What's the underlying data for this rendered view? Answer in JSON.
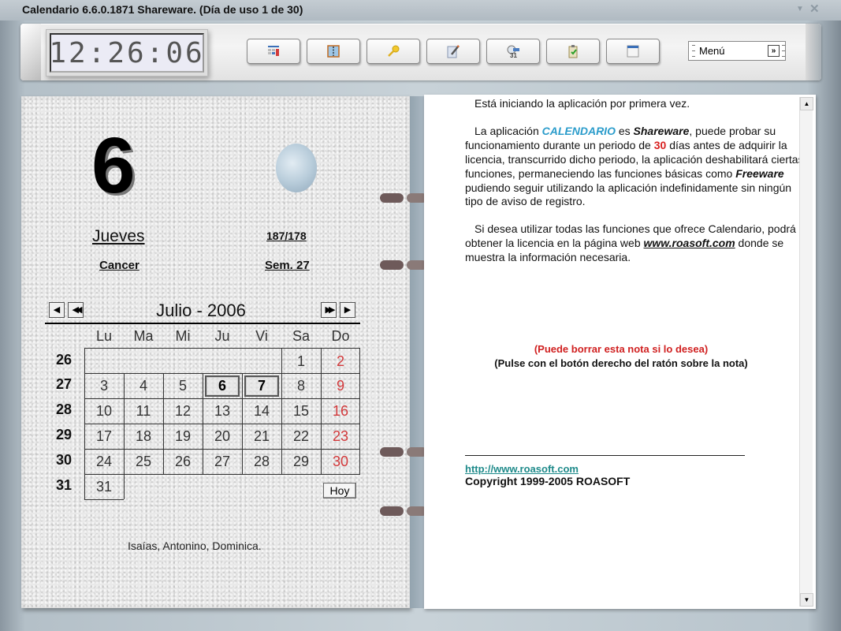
{
  "window": {
    "title": "Calendario 6.6.0.1871 Shareware.  (Día de uso 1 de 30)",
    "minimize_glyph": "▼",
    "close_glyph": "✕"
  },
  "toolbar": {
    "clock": "12:26:06",
    "buttons": [
      {
        "name": "calendar-view",
        "icon": "calendar-grid-icon"
      },
      {
        "name": "agenda",
        "icon": "notebook-icon"
      },
      {
        "name": "license-key",
        "icon": "key-icon"
      },
      {
        "name": "edit-note",
        "icon": "pencil-note-icon"
      },
      {
        "name": "alarm",
        "icon": "clock-alarm-icon"
      },
      {
        "name": "tasks",
        "icon": "clipboard-check-icon"
      },
      {
        "name": "window",
        "icon": "window-icon"
      }
    ],
    "menu": {
      "label": "Menú",
      "arrow": "⏬"
    }
  },
  "day_page": {
    "day_number": "6",
    "weekday": "Jueves",
    "day_of_year": "187/178",
    "zodiac": "Cancer",
    "week": "Sem. 27",
    "saints": "Isaías, Antonino, Dominica."
  },
  "calendar": {
    "month_title": "Julio - 2006",
    "nav": {
      "prev_month": "◀",
      "prev_year": "◀◀",
      "next_year": "▶▶",
      "next_month": "▶"
    },
    "weekdays": [
      "Lu",
      "Ma",
      "Mi",
      "Ju",
      "Vi",
      "Sa",
      "Do"
    ],
    "weeks": [
      {
        "number": "26",
        "days": [
          "",
          "",
          "",
          "",
          "",
          "1",
          "2"
        ]
      },
      {
        "number": "27",
        "days": [
          "3",
          "4",
          "5",
          "6",
          "7",
          "8",
          "9"
        ]
      },
      {
        "number": "28",
        "days": [
          "10",
          "11",
          "12",
          "13",
          "14",
          "15",
          "16"
        ]
      },
      {
        "number": "29",
        "days": [
          "17",
          "18",
          "19",
          "20",
          "21",
          "22",
          "23"
        ]
      },
      {
        "number": "30",
        "days": [
          "24",
          "25",
          "26",
          "27",
          "28",
          "29",
          "30"
        ]
      },
      {
        "number": "31",
        "days": [
          "31",
          "",
          "",
          "",
          "",
          "",
          ""
        ]
      }
    ],
    "selected_days": [
      "6",
      "7"
    ],
    "today_button": "Hoy",
    "sunday_color": "#d2383a"
  },
  "note": {
    "line1": "Está iniciando la aplicación por primera vez.",
    "p2_a": "La aplicación ",
    "p2_app": "CALENDARIO",
    "p2_b": " es ",
    "p2_shareware": "Shareware",
    "p2_c": ", puede probar su funcionamiento durante un periodo de ",
    "p2_days": "30",
    "p2_d": " días antes de adquirir la licencia, transcurrido dicho periodo, la aplicación deshabilitará ciertas funciones, permaneciendo las funciones básicas como ",
    "p2_freeware": "Freeware",
    "p2_e": " pudiendo seguir utilizando la aplicación indefinidamente sin ningún tipo de aviso de registro.",
    "p3_a": "Si desea utilizar todas las funciones que ofrece Calendario, podrá obtener la licencia en la página web ",
    "p3_web": "www.roasoft.com",
    "p3_b": " donde se muestra la información necesaria.",
    "notice_red": "(Puede borrar esta nota si lo desea)",
    "notice_black": "(Pulse con el botón derecho del ratón sobre la nota)",
    "url": "http://www.roasoft.com",
    "copyright": "Copyright 1999-2005 ROASOFT",
    "accent_color": "#2b9ccb"
  },
  "scrollbar": {
    "up": "▲",
    "down": "▼"
  }
}
